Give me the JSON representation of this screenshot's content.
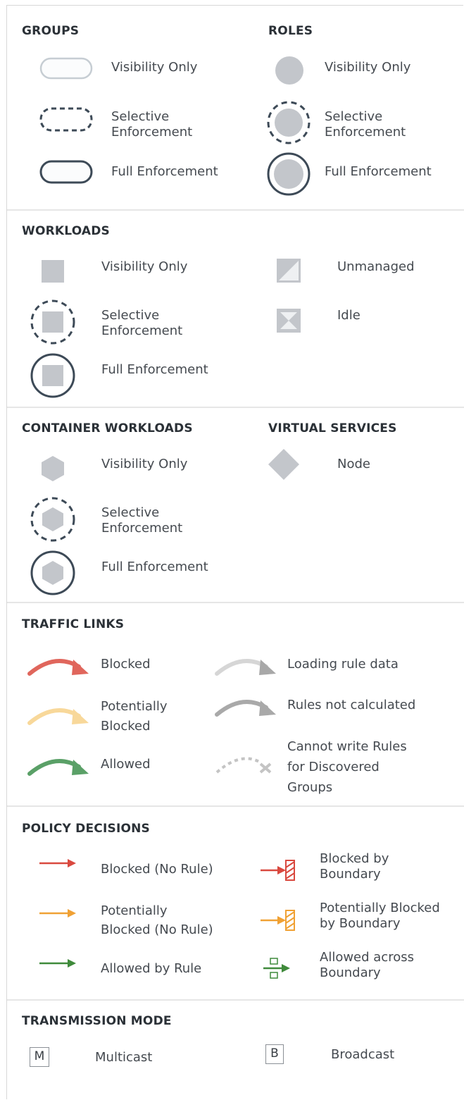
{
  "groups": {
    "title": "GROUPS",
    "items": [
      {
        "label": "Visibility Only"
      },
      {
        "label": "Selective\nEnforcement"
      },
      {
        "label": "Full Enforcement"
      }
    ]
  },
  "roles": {
    "title": "ROLES",
    "items": [
      {
        "label": "Visibility Only"
      },
      {
        "label": "Selective\nEnforcement"
      },
      {
        "label": "Full Enforcement"
      }
    ]
  },
  "workloads": {
    "title": "WORKLOADS",
    "items": [
      {
        "label": "Visibility Only"
      },
      {
        "label": "Selective\nEnforcement"
      },
      {
        "label": "Full Enforcement"
      },
      {
        "label": "Unmanaged"
      },
      {
        "label": "Idle"
      }
    ]
  },
  "container_workloads": {
    "title": "CONTAINER WORKLOADS",
    "items": [
      {
        "label": "Visibility Only"
      },
      {
        "label": "Selective\nEnforcement"
      },
      {
        "label": "Full Enforcement"
      }
    ]
  },
  "virtual_services": {
    "title": "VIRTUAL SERVICES",
    "items": [
      {
        "label": "Node"
      }
    ]
  },
  "traffic_links": {
    "title": "TRAFFIC LINKS",
    "items": [
      {
        "label": "Blocked",
        "color": "#e0665c"
      },
      {
        "label": "Potentially\nBlocked",
        "color": "#f8d89a"
      },
      {
        "label": "Allowed",
        "color": "#5aa067"
      },
      {
        "label": "Loading rule data",
        "color": "#d6d6d6"
      },
      {
        "label": "Rules not calculated",
        "color": "#a9a9a9"
      },
      {
        "label": "Cannot write Rules\nfor Discovered\nGroups",
        "color": "#c4c4c4"
      }
    ]
  },
  "policy_decisions": {
    "title": "POLICY DECISIONS",
    "items": [
      {
        "label": "Blocked (No Rule)",
        "color": "#d9493f"
      },
      {
        "label": "Potentially\nBlocked (No Rule)",
        "color": "#f0a134"
      },
      {
        "label": "Allowed by Rule",
        "color": "#3f8a3b"
      },
      {
        "label": "Blocked by\nBoundary",
        "color": "#d9493f"
      },
      {
        "label": "Potentially Blocked\nby Boundary",
        "color": "#f0a134"
      },
      {
        "label": "Allowed across\nBoundary",
        "color": "#3f8a3b"
      }
    ]
  },
  "transmission_mode": {
    "title": "TRANSMISSION MODE",
    "items": [
      {
        "badge": "M",
        "label": "Multicast"
      },
      {
        "badge": "B",
        "label": "Broadcast"
      }
    ]
  },
  "colors": {
    "outline": "#3d4a57",
    "fill_gray": "#c3c6cb",
    "divider": "#e6e6e6"
  }
}
